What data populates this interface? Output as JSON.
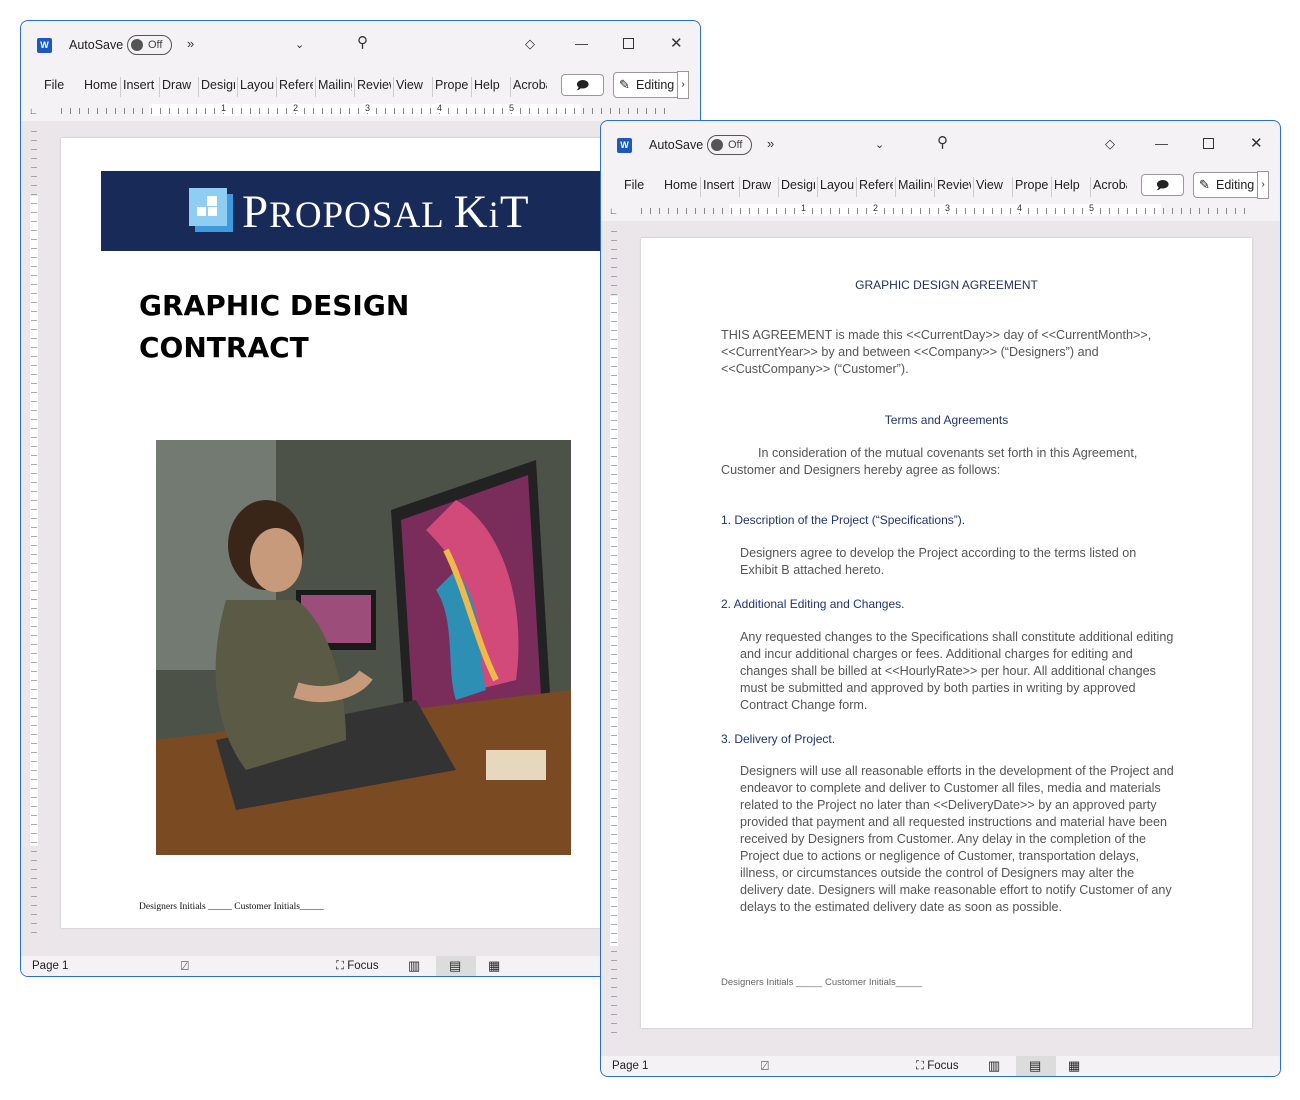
{
  "app": {
    "autosave_label": "AutoSave",
    "autosave_state": "Off",
    "word_icon": "W",
    "accent": "#2a6fc9",
    "banner_color": "#182a58",
    "heading_color": "#1f3470"
  },
  "ribbon": {
    "tabs": [
      "File",
      "Home",
      "Insert",
      "Draw",
      "Design",
      "Layout",
      "References",
      "Mailings",
      "Review",
      "View",
      "Properties",
      "Help",
      "Acrobat"
    ],
    "editing_label": "Editing"
  },
  "ruler": {
    "numbers": [
      "1",
      "2",
      "3",
      "4",
      "5"
    ]
  },
  "status": {
    "page": "Page 1",
    "focus": "Focus"
  },
  "cover": {
    "brand_main": "Proposal Kit",
    "brand_display": [
      "P",
      "ROPOSAL ",
      "K",
      "i",
      "T"
    ],
    "title_line1": "GRAPHIC DESIGN",
    "title_line2": "CONTRACT",
    "initials": "Designers Initials _____ Customer Initials_____"
  },
  "agreement": {
    "title": "GRAPHIC DESIGN AGREEMENT",
    "intro": "THIS AGREEMENT is made this <<CurrentDay>> day of <<CurrentMonth>>, <<CurrentYear>> by and between <<Company>> (“Designers”) and <<CustCompany>> (“Customer”).",
    "terms_heading": "Terms and Agreements",
    "consideration": "In consideration of the mutual covenants set forth in this Agreement, Customer and Designers hereby agree as follows:",
    "sections": [
      {
        "heading": "1. Description of the Project (“Specifications”).",
        "body": "Designers agree to develop the Project according to the terms listed on Exhibit B attached hereto."
      },
      {
        "heading": "2. Additional Editing and Changes.",
        "body": "Any requested changes to the Specifications shall constitute additional editing and incur additional charges or fees. Additional charges for editing and changes shall be billed at <<HourlyRate>> per hour. All additional changes must be submitted and approved by both parties in writing by approved Contract Change form."
      },
      {
        "heading": "3. Delivery of Project.",
        "body": "Designers will use all reasonable efforts in the development of the Project and endeavor to complete and deliver to Customer all files, media and materials related to the Project no later than <<DeliveryDate>> by an approved party provided that payment and all requested instructions and material have been received by Designers from Customer. Any delay in the completion of the Project due to actions or negligence of Customer, transportation delays, illness, or circumstances outside the control of Designers may alter the delivery date. Designers will make reasonable effort to notify Customer of any delays to the estimated delivery date as soon as possible."
      }
    ],
    "initials": "Designers Initials _____ Customer Initials_____"
  }
}
